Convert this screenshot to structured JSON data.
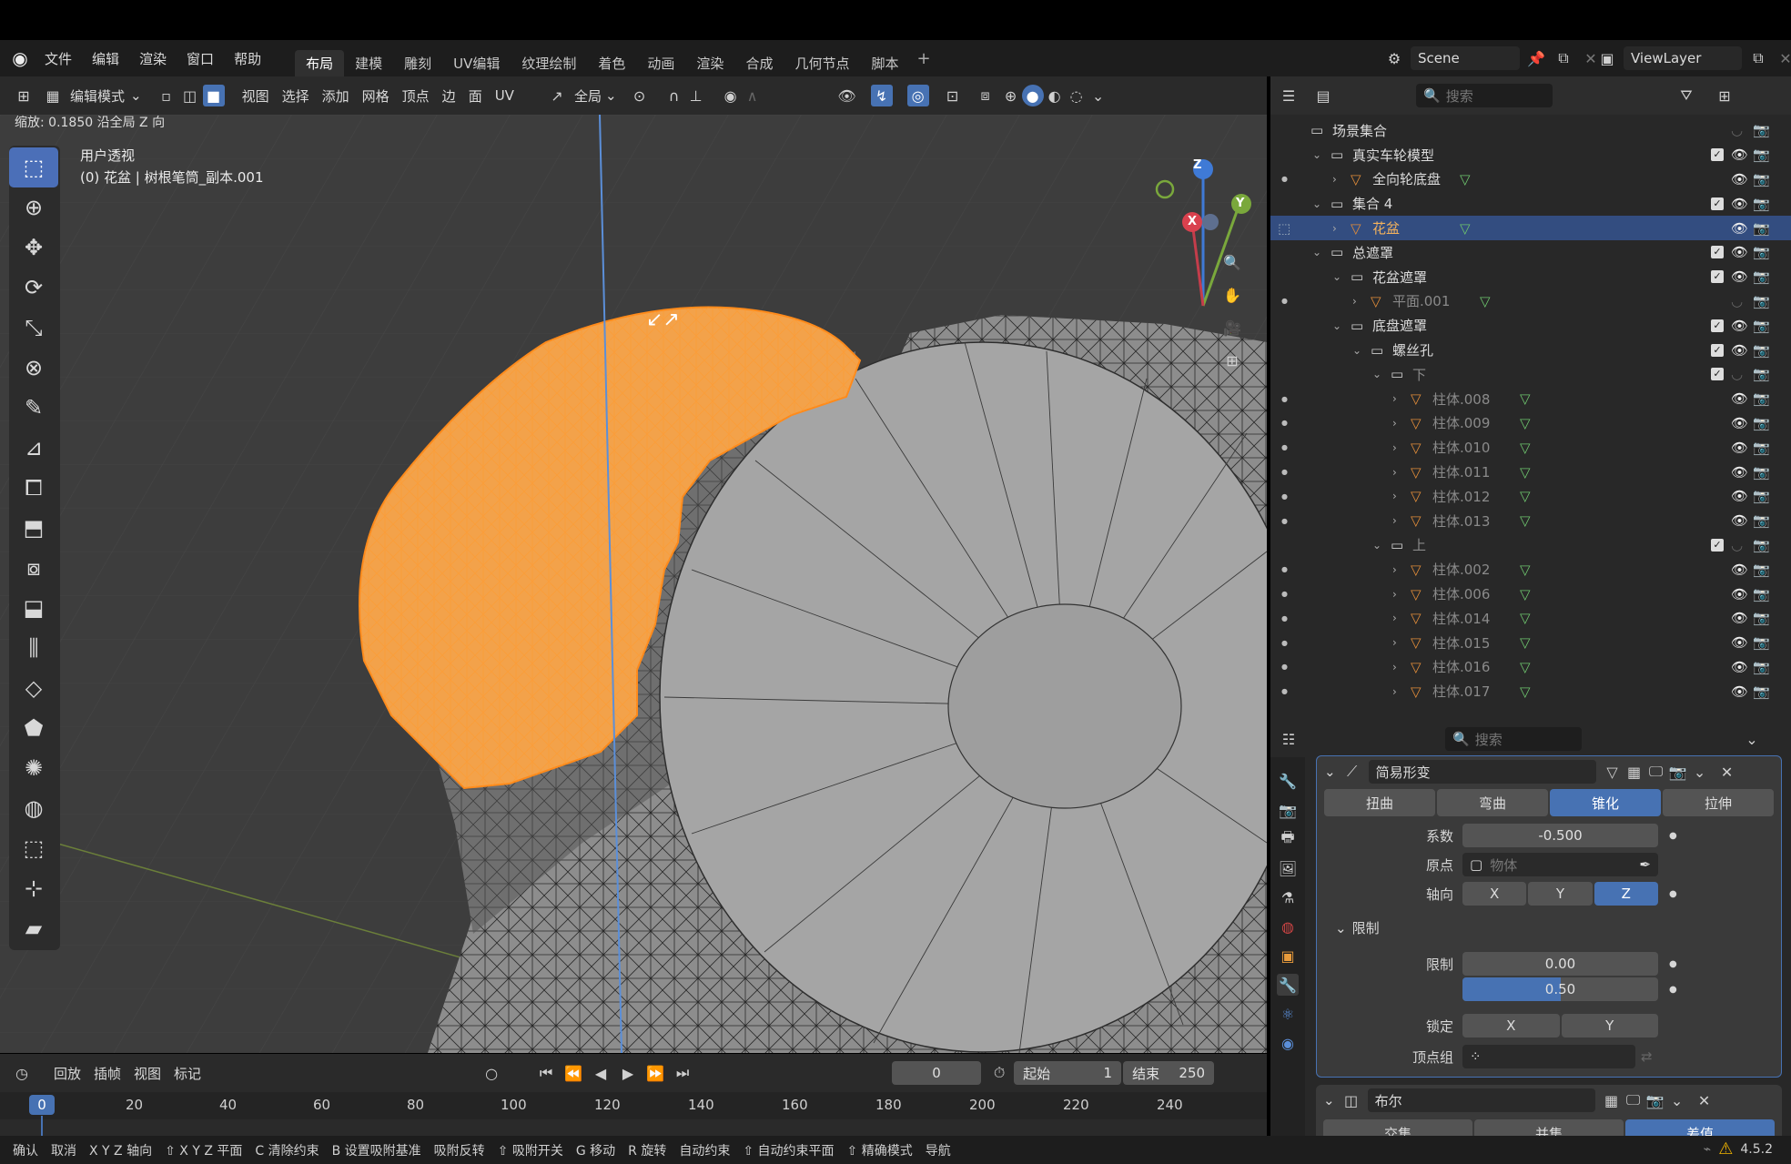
{
  "menubar": {
    "items": [
      "文件",
      "编辑",
      "渲染",
      "窗口",
      "帮助"
    ],
    "workspaces": [
      "布局",
      "建模",
      "雕刻",
      "UV编辑",
      "纹理绘制",
      "着色",
      "动画",
      "渲染",
      "合成",
      "几何节点",
      "脚本"
    ],
    "active_workspace": "布局",
    "add_tab": "+",
    "scene_label": "Scene",
    "viewlayer_label": "ViewLayer"
  },
  "header3d": {
    "mode": "编辑模式",
    "menus": [
      "视图",
      "选择",
      "添加",
      "网格",
      "顶点",
      "边",
      "面",
      "UV"
    ],
    "transform_orientation": "全局"
  },
  "viewport": {
    "status": "缩放: 0.1850 沿全局 Z 向",
    "view_name": "用户透视",
    "object_info": "(0) 花盆 | 树根笔筒_副本.001",
    "gizmo_axes": [
      "Z",
      "Y",
      "X"
    ]
  },
  "toolbar": {
    "tools": [
      "select-box",
      "cursor",
      "move",
      "rotate",
      "scale",
      "transform",
      "annotate",
      "measure",
      "add-cube",
      "extrude",
      "inset",
      "bevel",
      "loop-cut",
      "knife",
      "poly-build",
      "spin",
      "smooth",
      "edge-slide",
      "shrink-fatten",
      "shear",
      "rip"
    ]
  },
  "outliner": {
    "search_placeholder": "搜索",
    "rows": [
      {
        "label": "场景集合",
        "indent": 0,
        "type": "scene",
        "check": false,
        "eye": false,
        "cam": false,
        "arrow": ""
      },
      {
        "label": "真实车轮模型",
        "indent": 1,
        "type": "collection",
        "check": true,
        "eye": true,
        "cam": true,
        "arrow": "v"
      },
      {
        "label": "全向轮底盘",
        "indent": 2,
        "type": "mesh",
        "check": false,
        "eye": true,
        "cam": true,
        "arrow": ">",
        "dot": true
      },
      {
        "label": "集合 4",
        "indent": 1,
        "type": "collection",
        "check": true,
        "eye": true,
        "cam": true,
        "arrow": "v"
      },
      {
        "label": "花盆",
        "indent": 2,
        "type": "mesh",
        "check": false,
        "eye": true,
        "cam": true,
        "arrow": ">",
        "selected": true,
        "orange": true
      },
      {
        "label": "总遮罩",
        "indent": 1,
        "type": "collection",
        "check": true,
        "eye": true,
        "cam": true,
        "arrow": "v"
      },
      {
        "label": "花盆遮罩",
        "indent": 2,
        "type": "collection",
        "check": true,
        "eye": true,
        "cam": true,
        "arrow": "v"
      },
      {
        "label": "平面.001",
        "indent": 3,
        "type": "mesh",
        "check": false,
        "eye": false,
        "cam": true,
        "arrow": ">",
        "dot": true,
        "dim": true
      },
      {
        "label": "底盘遮罩",
        "indent": 2,
        "type": "collection",
        "check": true,
        "eye": true,
        "cam": true,
        "arrow": "v"
      },
      {
        "label": "螺丝孔",
        "indent": 3,
        "type": "collection",
        "check": true,
        "eye": true,
        "cam": true,
        "arrow": "v"
      },
      {
        "label": "下",
        "indent": 4,
        "type": "collection",
        "check": true,
        "eye": false,
        "cam": true,
        "arrow": "v",
        "dim": true
      },
      {
        "label": "柱体.008",
        "indent": 5,
        "type": "mesh",
        "check": false,
        "eye": true,
        "cam": true,
        "arrow": ">",
        "dot": true,
        "dim": true
      },
      {
        "label": "柱体.009",
        "indent": 5,
        "type": "mesh",
        "check": false,
        "eye": true,
        "cam": true,
        "arrow": ">",
        "dot": true,
        "dim": true
      },
      {
        "label": "柱体.010",
        "indent": 5,
        "type": "mesh",
        "check": false,
        "eye": true,
        "cam": true,
        "arrow": ">",
        "dot": true,
        "dim": true
      },
      {
        "label": "柱体.011",
        "indent": 5,
        "type": "mesh",
        "check": false,
        "eye": true,
        "cam": true,
        "arrow": ">",
        "dot": true,
        "dim": true
      },
      {
        "label": "柱体.012",
        "indent": 5,
        "type": "mesh",
        "check": false,
        "eye": true,
        "cam": true,
        "arrow": ">",
        "dot": true,
        "dim": true
      },
      {
        "label": "柱体.013",
        "indent": 5,
        "type": "mesh",
        "check": false,
        "eye": true,
        "cam": true,
        "arrow": ">",
        "dot": true,
        "dim": true
      },
      {
        "label": "上",
        "indent": 4,
        "type": "collection",
        "check": true,
        "eye": false,
        "cam": true,
        "arrow": "v",
        "dim": true
      },
      {
        "label": "柱体.002",
        "indent": 5,
        "type": "mesh",
        "check": false,
        "eye": true,
        "cam": true,
        "arrow": ">",
        "dot": true,
        "dim": true
      },
      {
        "label": "柱体.006",
        "indent": 5,
        "type": "mesh",
        "check": false,
        "eye": true,
        "cam": true,
        "arrow": ">",
        "dot": true,
        "dim": true
      },
      {
        "label": "柱体.014",
        "indent": 5,
        "type": "mesh",
        "check": false,
        "eye": true,
        "cam": true,
        "arrow": ">",
        "dot": true,
        "dim": true
      },
      {
        "label": "柱体.015",
        "indent": 5,
        "type": "mesh",
        "check": false,
        "eye": true,
        "cam": true,
        "arrow": ">",
        "dot": true,
        "dim": true
      },
      {
        "label": "柱体.016",
        "indent": 5,
        "type": "mesh",
        "check": false,
        "eye": true,
        "cam": true,
        "arrow": ">",
        "dot": true,
        "dim": true
      },
      {
        "label": "柱体.017",
        "indent": 5,
        "type": "mesh",
        "check": false,
        "eye": true,
        "cam": true,
        "arrow": ">",
        "dot": true,
        "dim": true
      }
    ]
  },
  "properties": {
    "search_placeholder": "搜索",
    "modifier1": {
      "name": "简易形变",
      "tabs": [
        "扭曲",
        "弯曲",
        "锥化",
        "拉伸"
      ],
      "active_tab": "锥化",
      "factor_label": "系数",
      "factor_value": "-0.500",
      "origin_label": "原点",
      "origin_placeholder": "物体",
      "axis_label": "轴向",
      "axes": [
        "X",
        "Y",
        "Z"
      ],
      "active_axis": "Z",
      "limits_section": "限制",
      "limits_label": "限制",
      "limit_min": "0.00",
      "limit_max": "0.50",
      "limit_max_fill": 0.5,
      "lock_label": "锁定",
      "lock_axes": [
        "X",
        "Y"
      ],
      "vgroup_label": "顶点组"
    },
    "modifier2": {
      "name": "布尔",
      "ops": [
        "交集",
        "并集",
        "差值"
      ],
      "active_op": "差值"
    }
  },
  "timeline": {
    "menus": [
      "回放",
      "插帧",
      "视图",
      "标记"
    ],
    "current_frame": "0",
    "start_label": "起始",
    "start_value": "1",
    "end_label": "结束",
    "end_value": "250",
    "ruler_current": "0",
    "ruler_ticks": [
      "20",
      "40",
      "60",
      "80",
      "100",
      "120",
      "140",
      "160",
      "180",
      "200",
      "220",
      "240"
    ]
  },
  "statusbar": {
    "items": [
      "确认",
      "取消",
      "X Y Z 轴向",
      "⇧ X Y Z 平面",
      "C 清除约束",
      "B 设置吸附基准",
      "吸附反转",
      "⇧ 吸附开关",
      "G 移动",
      "R 旋转",
      "自动约束",
      "⇧ 自动约束平面",
      "⇧ 精确模式",
      "导航"
    ],
    "version": "4.5.2"
  },
  "colors": {
    "accent": "#4772b3",
    "selection_orange": "#f59d3a",
    "viewport_bg": "#3e3e3e",
    "panel_bg": "#282828"
  }
}
